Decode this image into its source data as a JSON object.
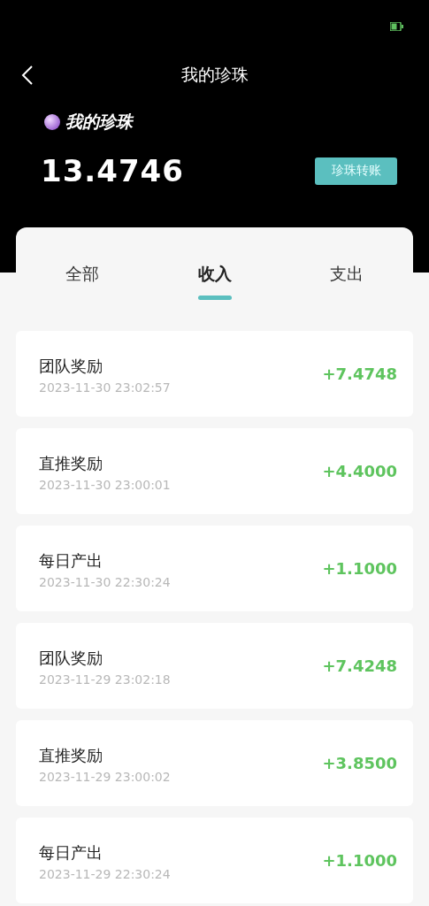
{
  "nav": {
    "title": "我的珍珠"
  },
  "balance": {
    "label": "我的珍珠",
    "amount": "13.4746",
    "button": "珍珠转账"
  },
  "tabs": [
    {
      "label": "全部",
      "selected": false
    },
    {
      "label": "收入",
      "selected": true
    },
    {
      "label": "支出",
      "selected": false
    }
  ],
  "records": [
    {
      "title": "团队奖励",
      "time": "2023-11-30 23:02:57",
      "amount": "+7.4748"
    },
    {
      "title": "直推奖励",
      "time": "2023-11-30 23:00:01",
      "amount": "+4.4000"
    },
    {
      "title": "每日产出",
      "time": "2023-11-30 22:30:24",
      "amount": "+1.1000"
    },
    {
      "title": "团队奖励",
      "time": "2023-11-29 23:02:18",
      "amount": "+7.4248"
    },
    {
      "title": "直推奖励",
      "time": "2023-11-29 23:00:02",
      "amount": "+3.8500"
    },
    {
      "title": "每日产出",
      "time": "2023-11-29 22:30:24",
      "amount": "+1.1000"
    }
  ]
}
